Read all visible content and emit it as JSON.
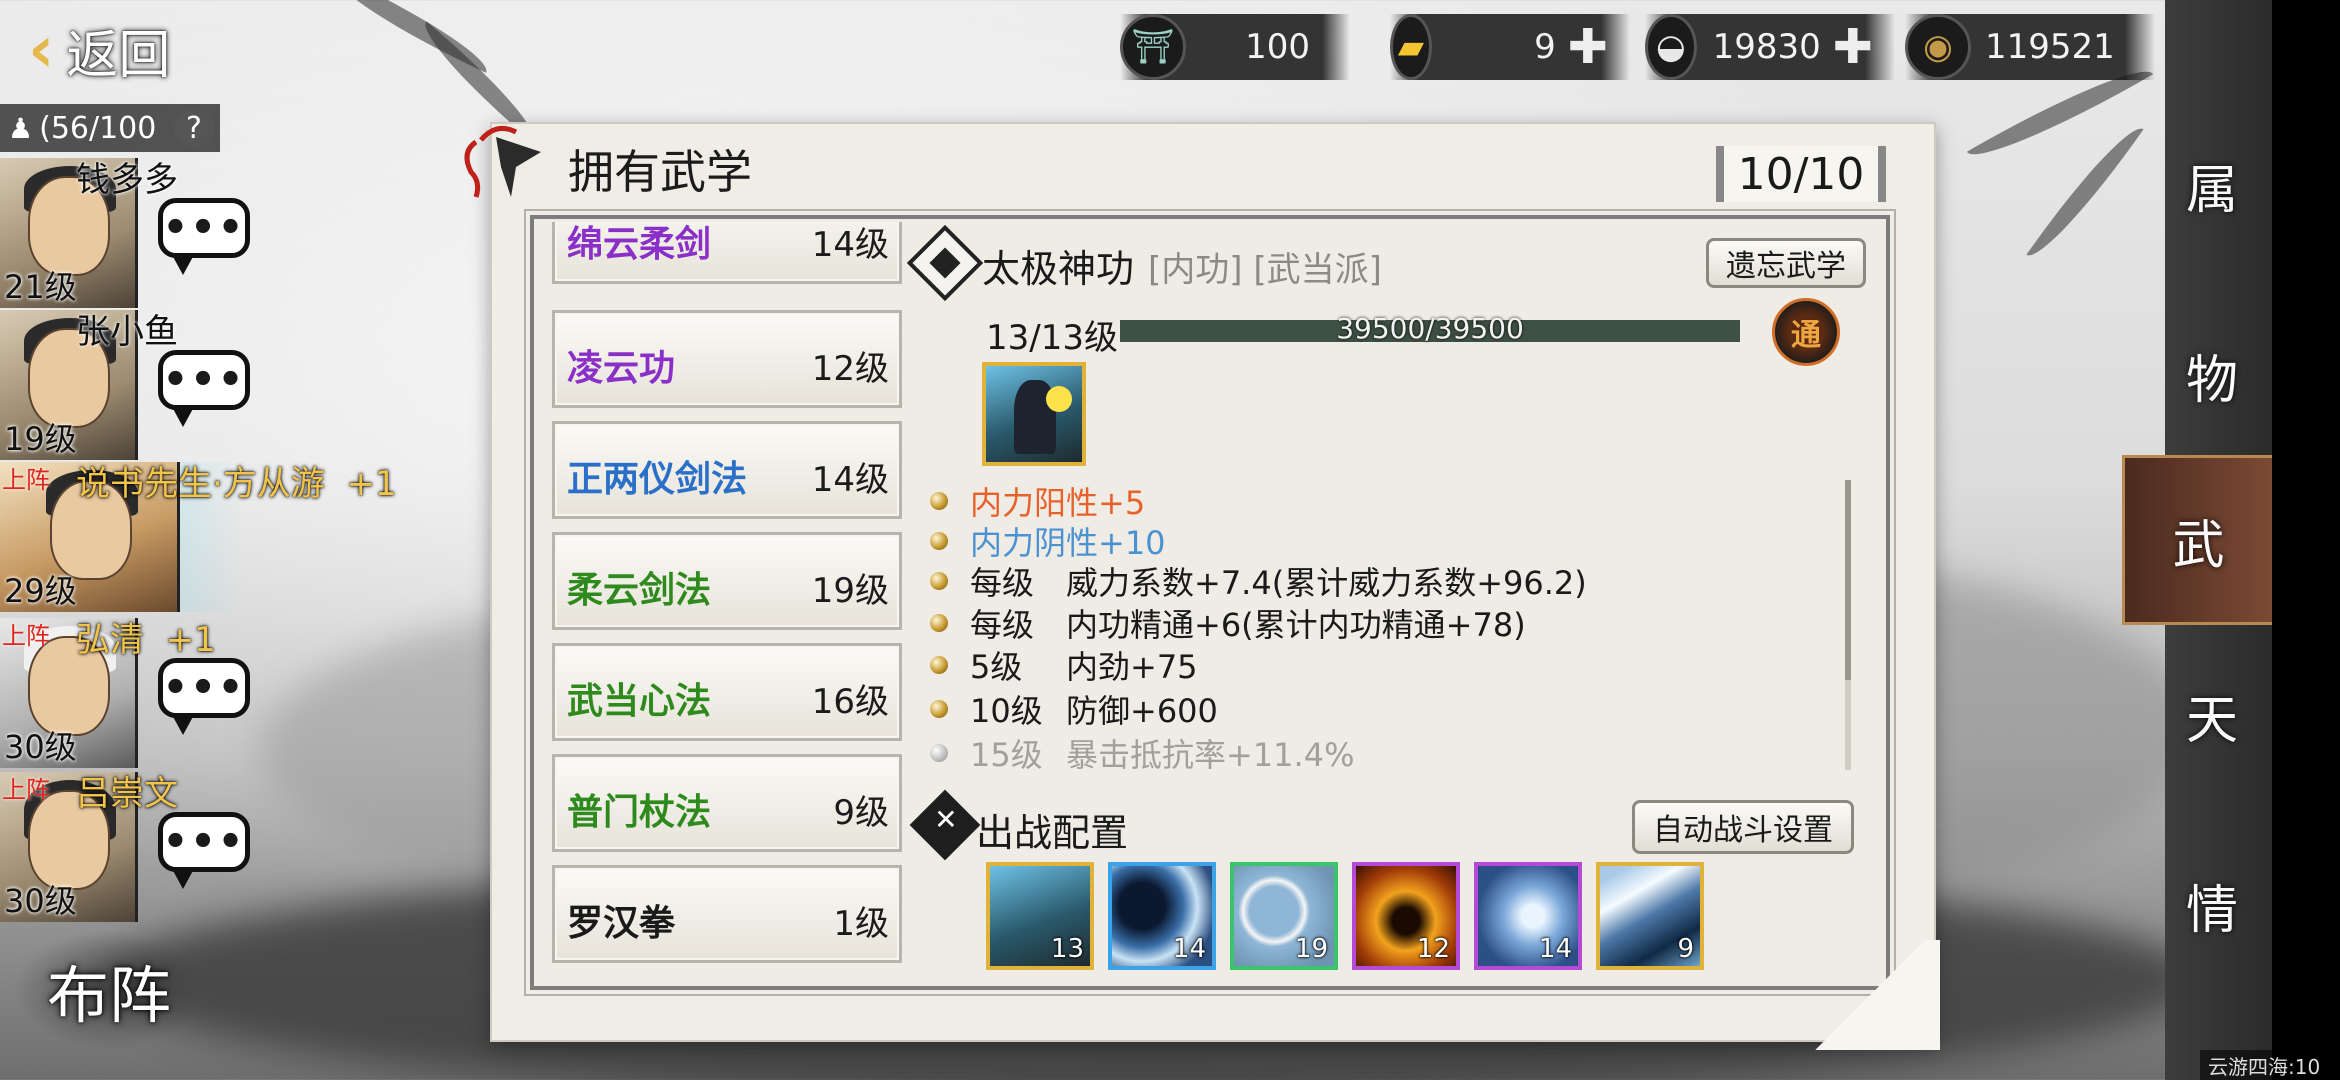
{
  "topbar": {
    "back_label": "返回",
    "resources": [
      {
        "icon": "stamina-cauldron-icon",
        "value": "100",
        "has_plus": false
      },
      {
        "icon": "gold-ingot-icon",
        "value": "9",
        "has_plus": true
      },
      {
        "icon": "silver-ingot-icon",
        "value": "19830",
        "has_plus": true
      },
      {
        "icon": "copper-coin-icon",
        "value": "119521",
        "has_plus": false
      }
    ],
    "plus_glyph": "✚"
  },
  "team": {
    "count_label": "(56/100",
    "help_glyph": "?",
    "members": [
      {
        "name": "钱多多",
        "level": "21级",
        "tag": "",
        "bonus": "",
        "selected": false,
        "gold": false
      },
      {
        "name": "张小鱼",
        "level": "19级",
        "tag": "",
        "bonus": "",
        "selected": false,
        "gold": false
      },
      {
        "name": "说书先生·方从游",
        "level": "29级",
        "tag": "上阵",
        "bonus": "+1",
        "selected": true,
        "gold": true
      },
      {
        "name": "弘清",
        "level": "30级",
        "tag": "上阵",
        "bonus": "+1",
        "selected": false,
        "gold": true
      },
      {
        "name": "吕崇文",
        "level": "30级",
        "tag": "上阵",
        "bonus": "",
        "selected": false,
        "gold": true
      }
    ],
    "chat_glyph": "•••",
    "formation_label": "布阵"
  },
  "panel": {
    "title": "拥有武学",
    "count": "10/10"
  },
  "skills": [
    {
      "name": "绵云柔剑",
      "level": "14级",
      "color": "purple"
    },
    {
      "name": "凌云功",
      "level": "12级",
      "color": "purple"
    },
    {
      "name": "正两仪剑法",
      "level": "14级",
      "color": "blue"
    },
    {
      "name": "柔云剑法",
      "level": "19级",
      "color": "green"
    },
    {
      "name": "武当心法",
      "level": "16级",
      "color": "green"
    },
    {
      "name": "普门杖法",
      "level": "9级",
      "color": "green"
    },
    {
      "name": "罗汉拳",
      "level": "1级",
      "color": "black"
    }
  ],
  "detail": {
    "name": "太极神功",
    "tags": "[内功] [武当派]",
    "forget_button": "遗忘武学",
    "level": "13/13级",
    "xp_text": "39500/39500",
    "xp_fraction": 1.0,
    "badge": "通",
    "effects": [
      {
        "key": "",
        "text": "内力阳性+5",
        "style": "orange"
      },
      {
        "key": "",
        "text": "内力阴性+10",
        "style": "lblue"
      },
      {
        "key": "每级",
        "text": "威力系数+7.4(累计威力系数+96.2)",
        "style": "normal"
      },
      {
        "key": "每级",
        "text": "内功精通+6(累计内功精通+78)",
        "style": "normal"
      },
      {
        "key": "5级",
        "text": "内劲+75",
        "style": "normal"
      },
      {
        "key": "10级",
        "text": "防御+600",
        "style": "normal"
      },
      {
        "key": "15级",
        "text": "暴击抵抗率+11.4%",
        "style": "dim"
      }
    ]
  },
  "battle": {
    "title": "出战配置",
    "auto_button": "自动战斗设置",
    "slots": [
      {
        "level": "13",
        "border": "gold",
        "art": "swordsman"
      },
      {
        "level": "14",
        "border": "blue",
        "art": "blade-arc"
      },
      {
        "level": "19",
        "border": "green",
        "art": "crescent"
      },
      {
        "level": "12",
        "border": "purple",
        "art": "fire-leap"
      },
      {
        "level": "14",
        "border": "purple",
        "art": "swirl"
      },
      {
        "level": "9",
        "border": "gold",
        "art": "slash-wave"
      }
    ]
  },
  "sidetabs": [
    {
      "label": "属",
      "active": false
    },
    {
      "label": "物",
      "active": false
    },
    {
      "label": "武",
      "active": true
    },
    {
      "label": "天",
      "active": false
    },
    {
      "label": "情",
      "active": false
    }
  ],
  "footer": "云游四海:10",
  "colors": {
    "gold_text": "#f2c44a",
    "purple": "#8a2fc7",
    "blue": "#2a70c8",
    "green": "#2f8a1e",
    "orange": "#e8612b",
    "light_blue": "#4b92d3"
  }
}
